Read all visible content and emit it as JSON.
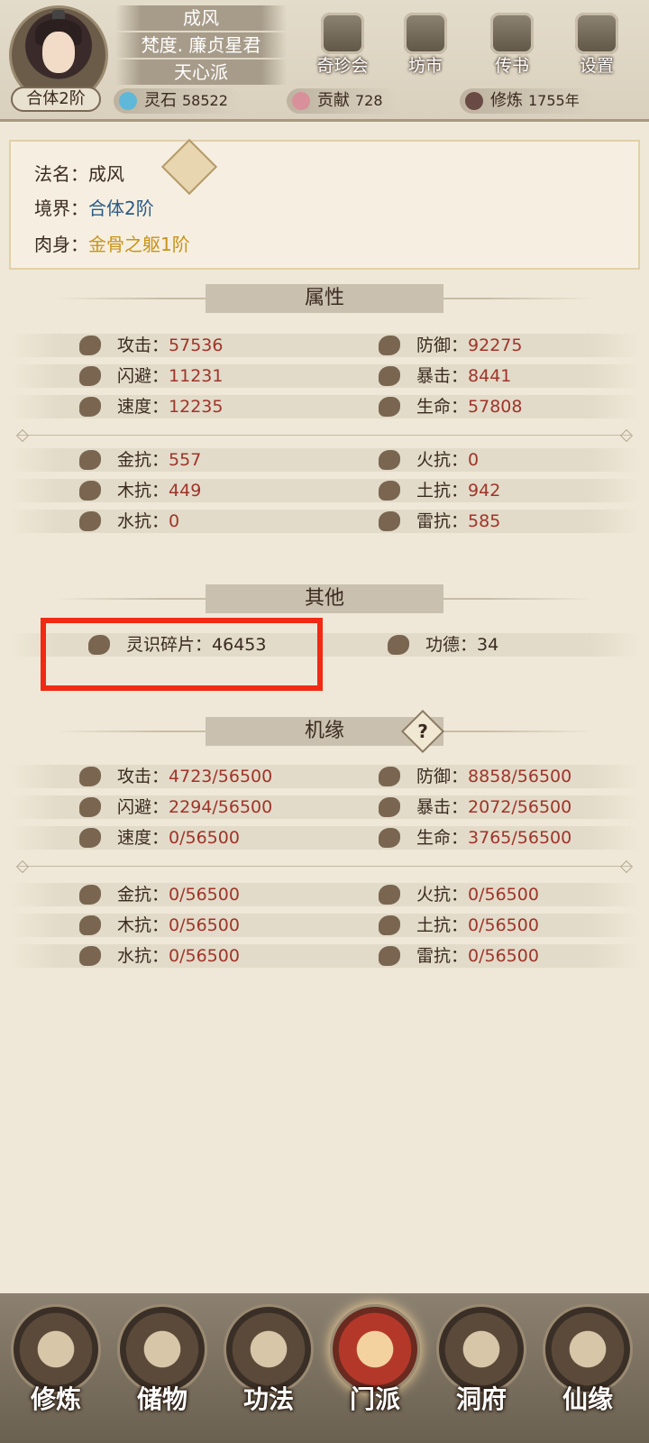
{
  "header": {
    "player_name": "成风",
    "title": "梵度. 廉贞星君",
    "sect": "天心派",
    "realm": "合体2阶",
    "nav": [
      {
        "label": "奇珍会",
        "icon": "treasure-pavilion-icon"
      },
      {
        "label": "坊市",
        "icon": "market-icon"
      },
      {
        "label": "传书",
        "icon": "scroll-letter-icon"
      },
      {
        "label": "设置",
        "icon": "gear-icon"
      }
    ],
    "resources": [
      {
        "label": "灵石",
        "value": "58522",
        "icon": "spirit-stone-icon",
        "color": "#5fb8d8"
      },
      {
        "label": "贡献",
        "value": "728",
        "icon": "contribution-icon",
        "color": "#d8909a"
      },
      {
        "label": "修炼",
        "value": "1755年",
        "icon": "cultivation-icon",
        "color": "#6a4a44"
      }
    ]
  },
  "info": {
    "name_label": "法名：",
    "name_value": "成风",
    "realm_label": "境界：",
    "realm_value": "合体2阶",
    "body_label": "肉身：",
    "body_value": "金骨之躯1阶"
  },
  "sections": {
    "attributes": "属性",
    "other": "其他",
    "fortune": "机缘",
    "help": "?"
  },
  "attributes": {
    "combat": [
      {
        "label": "攻击：",
        "value": "57536",
        "icon": "attack-icon"
      },
      {
        "label": "防御：",
        "value": "92275",
        "icon": "defense-icon"
      },
      {
        "label": "闪避：",
        "value": "11231",
        "icon": "dodge-icon"
      },
      {
        "label": "暴击：",
        "value": "8441",
        "icon": "critical-icon"
      },
      {
        "label": "速度：",
        "value": "12235",
        "icon": "speed-icon"
      },
      {
        "label": "生命：",
        "value": "57808",
        "icon": "life-icon"
      }
    ],
    "resist": [
      {
        "label": "金抗：",
        "value": "557",
        "icon": "metal-resist-icon"
      },
      {
        "label": "火抗：",
        "value": "0",
        "icon": "fire-resist-icon"
      },
      {
        "label": "木抗：",
        "value": "449",
        "icon": "wood-resist-icon"
      },
      {
        "label": "土抗：",
        "value": "942",
        "icon": "earth-resist-icon"
      },
      {
        "label": "水抗：",
        "value": "0",
        "icon": "water-resist-icon"
      },
      {
        "label": "雷抗：",
        "value": "585",
        "icon": "thunder-resist-icon"
      }
    ]
  },
  "other": [
    {
      "label": "灵识碎片：",
      "value": "46453",
      "icon": "spirit-shard-icon"
    },
    {
      "label": "功德：",
      "value": "34",
      "icon": "merit-icon"
    }
  ],
  "fortune": {
    "combat": [
      {
        "label": "攻击：",
        "value": "4723/56500"
      },
      {
        "label": "防御：",
        "value": "8858/56500"
      },
      {
        "label": "闪避：",
        "value": "2294/56500"
      },
      {
        "label": "暴击：",
        "value": "2072/56500"
      },
      {
        "label": "速度：",
        "value": "0/56500"
      },
      {
        "label": "生命：",
        "value": "3765/56500"
      }
    ],
    "resist": [
      {
        "label": "金抗：",
        "value": "0/56500"
      },
      {
        "label": "火抗：",
        "value": "0/56500"
      },
      {
        "label": "木抗：",
        "value": "0/56500"
      },
      {
        "label": "土抗：",
        "value": "0/56500"
      },
      {
        "label": "水抗：",
        "value": "0/56500"
      },
      {
        "label": "雷抗：",
        "value": "0/56500"
      }
    ]
  },
  "bottom_nav": [
    {
      "label": "修炼",
      "icon": "cultivate-icon"
    },
    {
      "label": "储物",
      "icon": "storage-bag-icon"
    },
    {
      "label": "功法",
      "icon": "technique-scroll-icon"
    },
    {
      "label": "门派",
      "icon": "sect-gate-icon",
      "active": true
    },
    {
      "label": "洞府",
      "icon": "cave-abode-icon"
    },
    {
      "label": "仙缘",
      "icon": "immortal-fate-icon"
    }
  ],
  "colors": {
    "value_red": "#a0342a",
    "realm_blue": "#2a5a88",
    "body_gold": "#c8931a",
    "highlight": "#f02a14"
  }
}
